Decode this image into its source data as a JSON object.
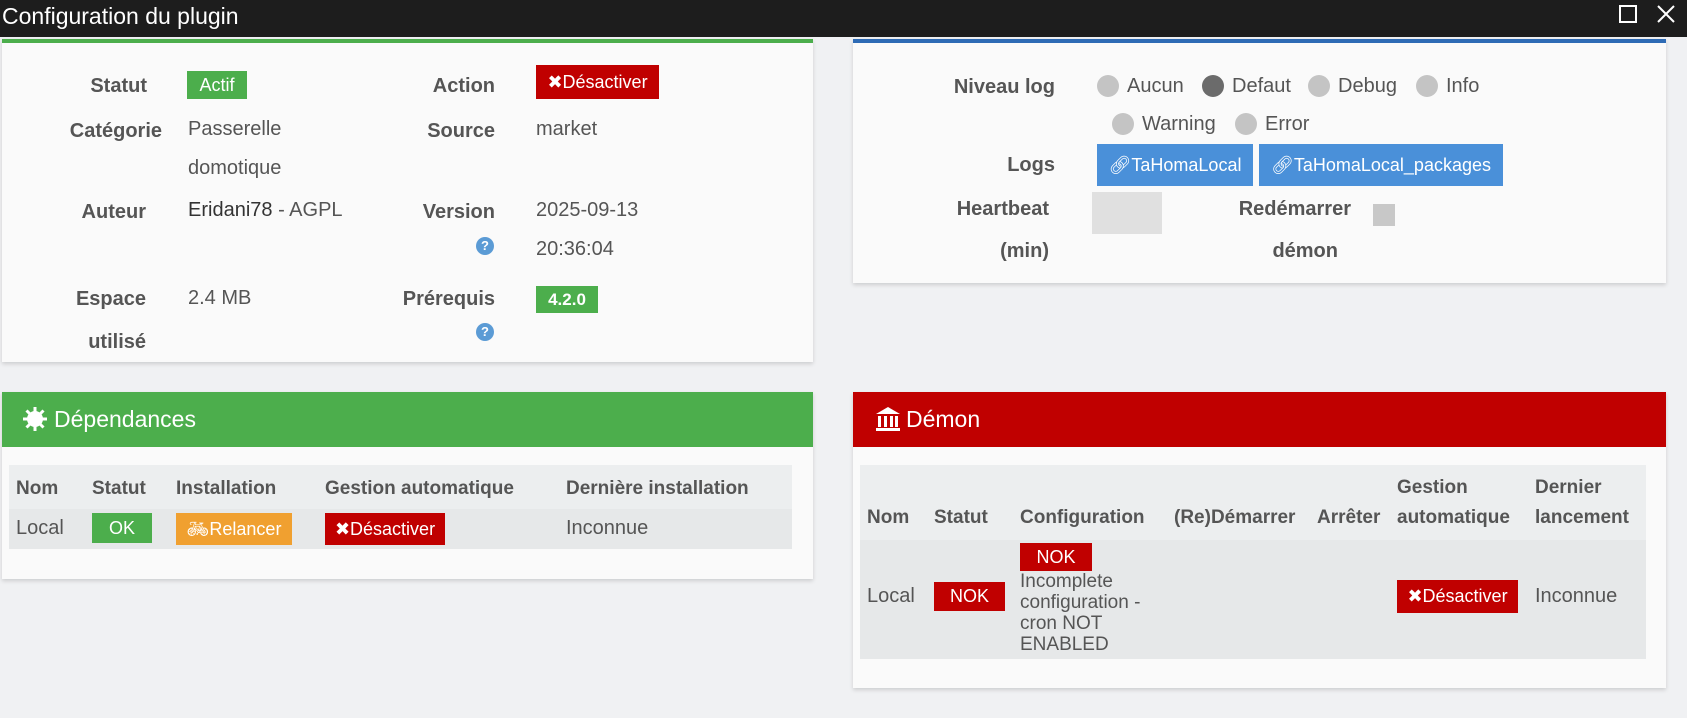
{
  "window": {
    "title": "Configuration du plugin",
    "maximize_icon": "maximize-icon",
    "close_icon": "close-icon"
  },
  "info": {
    "statut_label": "Statut",
    "statut_badge": "Actif",
    "action_label": "Action",
    "action_button": "Désactiver",
    "categorie_label": "Catégorie",
    "categorie_line1": "Passerelle",
    "categorie_line2": "domotique",
    "source_label": "Source",
    "source_value": "market",
    "auteur_label": "Auteur",
    "auteur_name": "Eridani78",
    "auteur_license": " - AGPL",
    "version_label": "Version",
    "version_line1": "2025-09-13",
    "version_line2": "20:36:04",
    "espace_label_line1": "Espace",
    "espace_label_line2": "utilisé",
    "espace_value": "2.4 MB",
    "prerequis_label": "Prérequis",
    "prerequis_badge": "4.2.0",
    "help_glyph": "?"
  },
  "log": {
    "niveau_label": "Niveau log",
    "levels": [
      "Aucun",
      "Defaut",
      "Debug",
      "Info",
      "Warning",
      "Error"
    ],
    "selected": "Defaut",
    "logs_label": "Logs",
    "log_buttons": [
      "TaHomaLocal",
      "TaHomaLocal_packages"
    ],
    "heartbeat_line1": "Heartbeat",
    "heartbeat_line2": "(min)",
    "heartbeat_value": "",
    "redemarrer_line1": "Redémarrer",
    "redemarrer_line2": "démon"
  },
  "dependances": {
    "title": "Dépendances",
    "headers": [
      "Nom",
      "Statut",
      "Installation",
      "Gestion automatique",
      "Dernière installation"
    ],
    "row": {
      "nom": "Local",
      "statut": "OK",
      "installation": "Relancer",
      "gestion": "Désactiver",
      "derniere": "Inconnue"
    }
  },
  "demon": {
    "title": "Démon",
    "headers": {
      "nom": "Nom",
      "statut": "Statut",
      "configuration": "Configuration",
      "redemarrer": "(Re)Démarrer",
      "arreter": "Arrêter",
      "gestion_l1": "Gestion",
      "gestion_l2": "automatique",
      "dernier_l1": "Dernier",
      "dernier_l2": "lancement"
    },
    "row": {
      "nom": "Local",
      "statut": "NOK",
      "config_badge": "NOK",
      "config_line1": "Incomplete",
      "config_line2": "configuration -",
      "config_line3": "cron NOT",
      "config_line4": "ENABLED",
      "gestion": "Désactiver",
      "dernier": "Inconnue"
    }
  },
  "colors": {
    "green": "#4cae4c",
    "red": "#c00000",
    "blue": "#4a90d9",
    "orange": "#f0a030"
  }
}
